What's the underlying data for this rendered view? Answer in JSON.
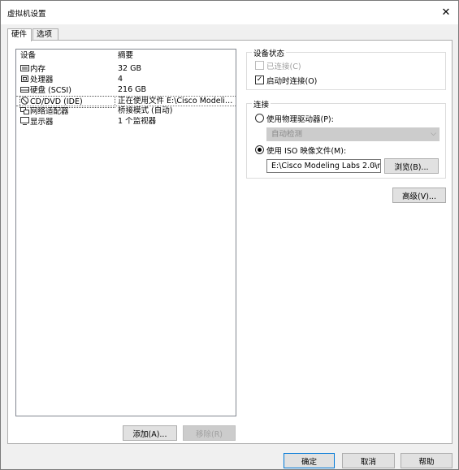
{
  "window": {
    "title": "虚拟机设置",
    "close_glyph": "✕"
  },
  "tabs": [
    {
      "label": "硬件"
    },
    {
      "label": "选项"
    }
  ],
  "device_list": {
    "headers": {
      "device": "设备",
      "summary": "摘要"
    },
    "rows": [
      {
        "device": "内存",
        "summary": "32 GB",
        "icon": "memory-icon"
      },
      {
        "device": "处理器",
        "summary": "4",
        "icon": "cpu-icon"
      },
      {
        "device": "硬盘 (SCSI)",
        "summary": "216 GB",
        "icon": "hard-disk-icon"
      },
      {
        "device": "CD/DVD (IDE)",
        "summary": "正在使用文件 E:\\Cisco Modelin...",
        "icon": "cd-dvd-icon",
        "selected": true
      },
      {
        "device": "网络适配器",
        "summary": "桥接模式 (自动)",
        "icon": "network-adapter-icon"
      },
      {
        "device": "显示器",
        "summary": "1 个监视器",
        "icon": "display-icon"
      }
    ]
  },
  "list_buttons": {
    "add": "添加(A)...",
    "remove": "移除(R)"
  },
  "device_status": {
    "title": "设备状态",
    "connected": {
      "label": "已连接(C)",
      "checked": false,
      "enabled": false
    },
    "connect_at_power_on": {
      "label": "启动时连接(O)",
      "checked": true,
      "enabled": true
    }
  },
  "connection": {
    "title": "连接",
    "physical": {
      "label": "使用物理驱动器(P):",
      "selected": false
    },
    "physical_select": {
      "value": "自动检测"
    },
    "iso": {
      "label": "使用 ISO 映像文件(M):",
      "selected": true
    },
    "iso_select": {
      "value": "E:\\Cisco Modeling Labs 2.0\\r"
    },
    "browse": "浏览(B)..."
  },
  "advanced_button": "高级(V)...",
  "footer": {
    "ok": "确定",
    "cancel": "取消",
    "help": "帮助"
  }
}
